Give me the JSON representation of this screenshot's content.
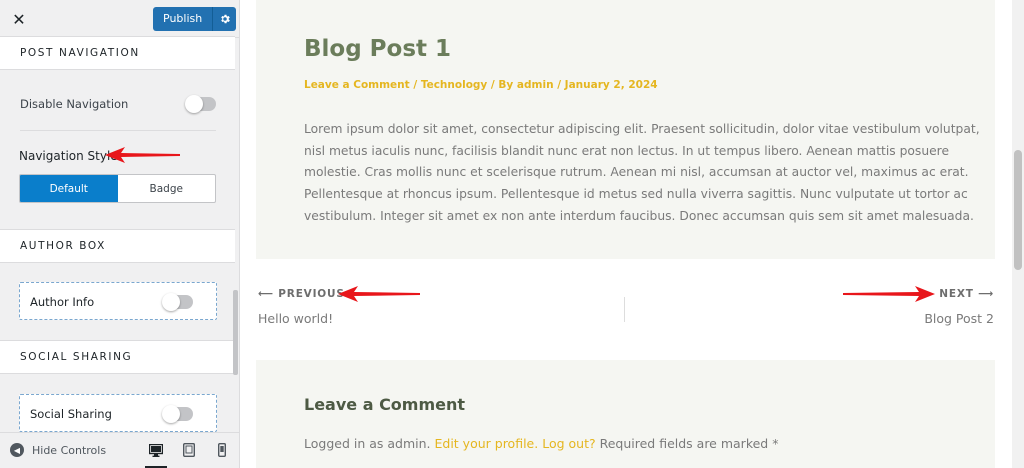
{
  "customizer": {
    "close_glyph": "✕",
    "publish_label": "Publish",
    "sections": {
      "post_navigation": {
        "title": "POST NAVIGATION",
        "disable_navigation_label": "Disable Navigation",
        "disable_navigation_on": false,
        "navigation_style_label": "Navigation Style",
        "style_options": [
          "Default",
          "Badge"
        ],
        "style_selected": "Default"
      },
      "author_box": {
        "title": "AUTHOR BOX",
        "author_info_label": "Author Info",
        "author_info_on": false
      },
      "social_sharing": {
        "title": "SOCIAL SHARING",
        "social_sharing_label": "Social Sharing",
        "social_sharing_on": false
      }
    },
    "footer": {
      "hide_controls_label": "Hide Controls",
      "devices": [
        "desktop-icon",
        "tablet-icon",
        "mobile-icon"
      ],
      "active_device": "desktop-icon"
    }
  },
  "preview": {
    "post_title": "Blog Post 1",
    "meta": "Leave a Comment / Technology / By admin / January 2, 2024",
    "excerpt": "Lorem ipsum dolor sit amet, consectetur adipiscing elit. Praesent sollicitudin, dolor vitae vestibulum volutpat, nisl metus iaculis nunc, facilisis blandit nunc erat non lectus. In ut tempus libero. Aenean mattis posuere molestie. Cras mollis nunc et scelerisque rutrum. Aenean mi nisl, accumsan at auctor vel, maximus ac erat. Pellentesque at rhoncus ipsum. Pellentesque id metus sed nulla viverra sagittis. Nunc vulputate ut tortor ac vestibulum. Integer sit amet ex non ante interdum faucibus. Donec accumsan quis sem sit amet malesuada.",
    "nav": {
      "previous_label": "⟵ PREVIOUS",
      "previous_title": "Hello world!",
      "next_label": "NEXT ⟶",
      "next_title": "Blog Post 2"
    },
    "comment": {
      "title": "Leave a Comment",
      "logged_in_prefix": "Logged in as admin.",
      "edit_profile": "Edit your profile.",
      "logout": "Log out?",
      "required_text": "Required fields are marked *"
    }
  },
  "colors": {
    "accent_blue": "#0a7ecb",
    "title_green": "#6b7d5b",
    "meta_gold": "#e5b620",
    "annotation_red": "#e8161b"
  }
}
